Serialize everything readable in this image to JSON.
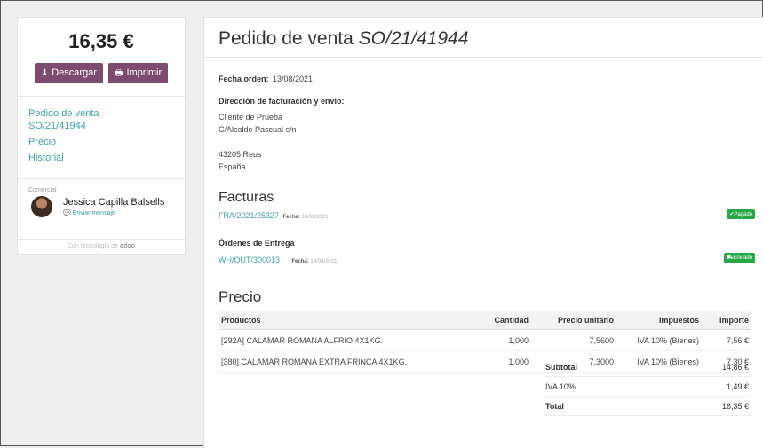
{
  "sidebar": {
    "amount": "16,35 €",
    "download_label": "Descargar",
    "print_label": "Imprimir",
    "nav": [
      "Pedido de venta",
      "SO/21/41944",
      "Precio",
      "Historial"
    ],
    "salesperson_heading": "Comercial",
    "salesperson_name": "Jessica Capilla Balsells",
    "send_message": "Enviar mensaje",
    "powered_by": "Con tecnología de",
    "powered_brand": "odoo"
  },
  "order": {
    "title_prefix": "Pedido de venta",
    "title_ref": "SO/21/41944",
    "date_label": "Fecha orden:",
    "date_value": "13/08/2021",
    "address_label": "Dirección de facturación y envío:",
    "address_lines": [
      "Cliente de Prueba",
      "C/Alcalde Pascual s/n",
      "",
      "43205 Reus",
      "España"
    ],
    "invoices_label": "Facturas",
    "invoice_ref": "FRA/2021/25327",
    "invoice_date_label": "Fecha:",
    "invoice_date": "13/08/2021",
    "invoice_status": "Pagado",
    "deliveries_label": "Órdenes de Entrega",
    "delivery_ref": "WH/OUT/300013",
    "delivery_date_label": "Fecha:",
    "delivery_date": "13/08/2021",
    "delivery_status": "Enviado"
  },
  "pricing": {
    "heading": "Precio",
    "columns": [
      "Productos",
      "Cantidad",
      "Precio unitario",
      "Impuestos",
      "Importe"
    ],
    "rows": [
      {
        "product": "[292A] CALAMAR ROMANA ALFRIO 4X1KG.",
        "qty": "1,000",
        "unit": "7,5600",
        "tax": "IVA 10% (Bienes)",
        "amount": "7,56 €"
      },
      {
        "product": "[380] CALAMAR ROMANA EXTRA FRINCA 4X1KG.",
        "qty": "1,000",
        "unit": "7,3000",
        "tax": "IVA 10% (Bienes)",
        "amount": "7,30 €"
      }
    ],
    "subtotal_label": "Subtotal",
    "subtotal_value": "14,86 €",
    "tax_label": "IVA 10%",
    "tax_value": "1,49 €",
    "total_label": "Total",
    "total_value": "16,35 €"
  },
  "colors": {
    "accent": "#7c4b6f",
    "link": "#3ea1a8",
    "success": "#28a745"
  }
}
